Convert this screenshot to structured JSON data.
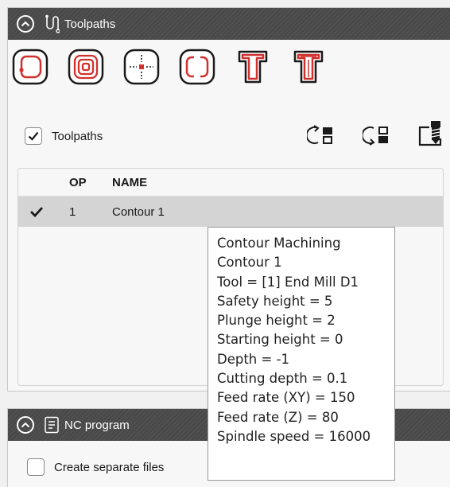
{
  "toolpaths_panel": {
    "title": "Toolpaths",
    "buttons": [
      {
        "icon": "contour-toolpath-icon"
      },
      {
        "icon": "pocket-toolpath-icon"
      },
      {
        "icon": "drill-toolpath-icon"
      },
      {
        "icon": "profile-toolpath-icon"
      },
      {
        "icon": "text-engrave-toolpath-icon"
      },
      {
        "icon": "text-outline-toolpath-icon"
      }
    ],
    "show_toolpaths_label": "Toolpaths",
    "show_toolpaths_checked": true,
    "table": {
      "columns": [
        "OP",
        "NAME"
      ],
      "rows": [
        {
          "checked": true,
          "op": "1",
          "name": "Contour 1",
          "selected": true
        }
      ]
    }
  },
  "tooltip": {
    "lines": [
      "Contour Machining",
      "Contour 1",
      "Tool = [1] End Mill D1",
      "Safety height = 5",
      "Plunge height = 2",
      "Starting height = 0",
      "Depth = -1",
      "Cutting depth = 0.1",
      "Feed rate (XY) = 150",
      "Feed rate (Z) = 80",
      "Spindle speed = 16000"
    ]
  },
  "nc_panel": {
    "title": "NC program",
    "separate_files_label": "Create separate files",
    "separate_files_checked": false
  },
  "colors": {
    "header_bg": "#4a4a4a",
    "accent_red": "#d0312d",
    "selected_row": "#d4d4d4"
  }
}
